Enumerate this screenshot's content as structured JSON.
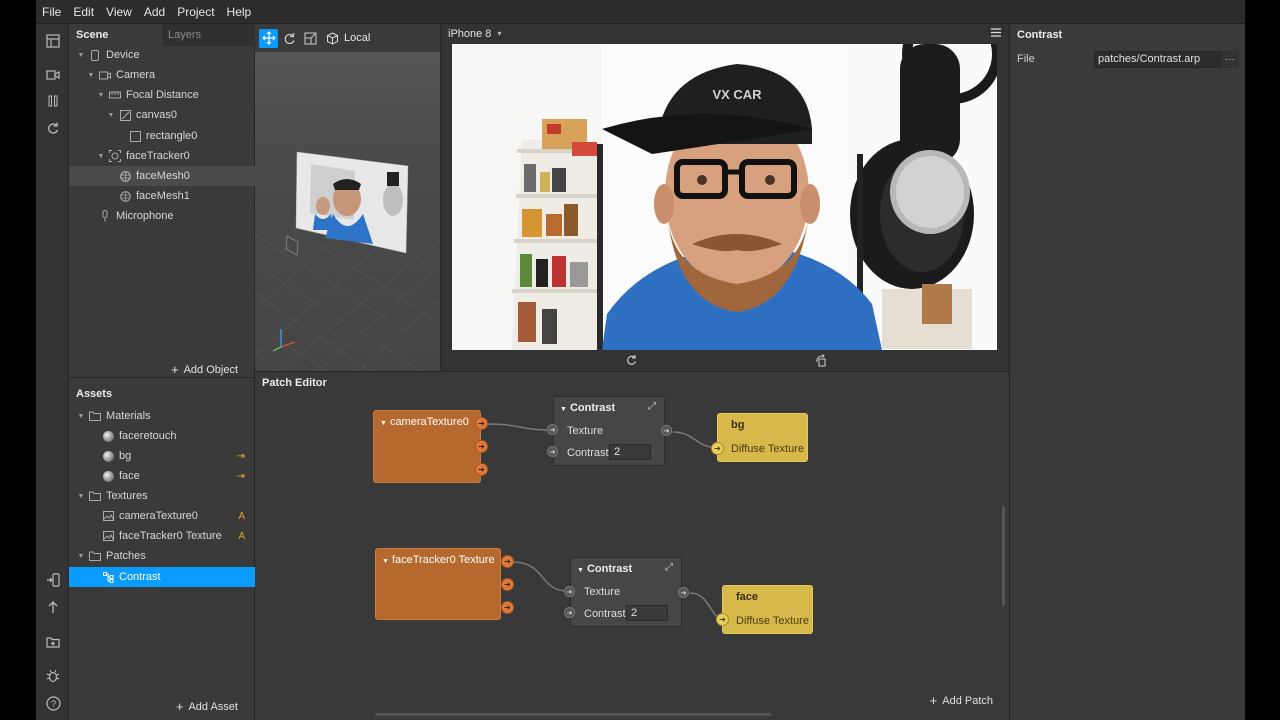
{
  "menubar": [
    "File",
    "Edit",
    "View",
    "Add",
    "Project",
    "Help"
  ],
  "scene": {
    "title": "Scene",
    "layers_tab": "Layers",
    "tree": [
      {
        "label": "Device"
      },
      {
        "label": "Camera"
      },
      {
        "label": "Focal Distance"
      },
      {
        "label": "canvas0"
      },
      {
        "label": "rectangle0"
      },
      {
        "label": "faceTracker0"
      },
      {
        "label": "faceMesh0"
      },
      {
        "label": "faceMesh1"
      },
      {
        "label": "Microphone"
      }
    ],
    "add_object": "Add Object"
  },
  "assets": {
    "title": "Assets",
    "rows": [
      {
        "label": "Materials"
      },
      {
        "label": "faceretouch"
      },
      {
        "label": "bg",
        "badge": "⇥"
      },
      {
        "label": "face",
        "badge": "⇥"
      },
      {
        "label": "Textures"
      },
      {
        "label": "cameraTexture0",
        "badge": "A"
      },
      {
        "label": "faceTracker0 Texture",
        "badge": "A"
      },
      {
        "label": "Patches"
      },
      {
        "label": "Contrast"
      }
    ],
    "add_asset": "Add Asset"
  },
  "viewport": {
    "mode_label": "Local"
  },
  "simulator": {
    "device": "iPhone 8"
  },
  "inspector": {
    "title": "Contrast",
    "file_label": "File",
    "file_value": "patches/Contrast.arp",
    "more": "···"
  },
  "patch_editor": {
    "title": "Patch Editor",
    "nodes": {
      "camera_texture": "cameraTexture0",
      "contrast1_title": "Contrast",
      "contrast1_texture": "Texture",
      "contrast1_contrast": "Contrast",
      "contrast1_value": "2",
      "bg_title": "bg",
      "bg_port": "Diffuse Texture",
      "facetracker_texture": "faceTracker0 Texture",
      "contrast2_title": "Contrast",
      "contrast2_texture": "Texture",
      "contrast2_contrast": "Contrast",
      "contrast2_value": "2",
      "face_title": "face",
      "face_port": "Diffuse Texture"
    },
    "add_patch": "Add Patch"
  }
}
